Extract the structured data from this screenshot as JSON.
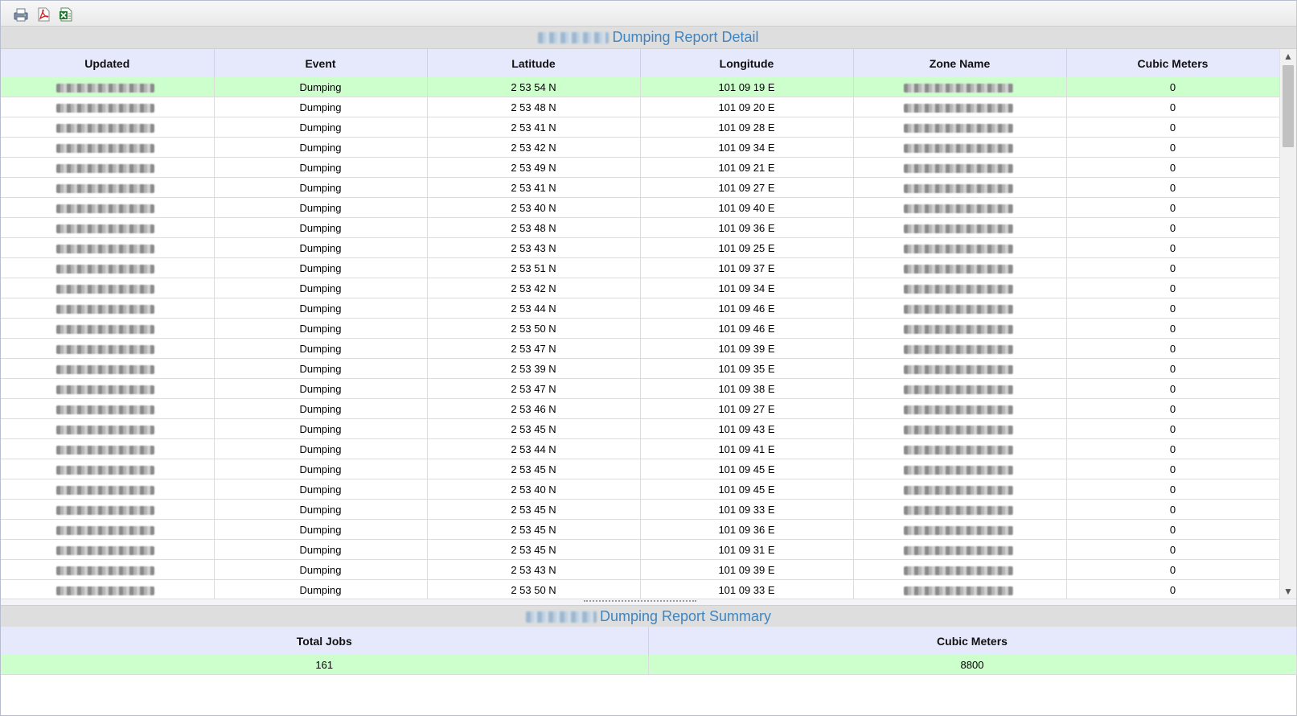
{
  "toolbar": {
    "icons": [
      "print-icon",
      "pdf-icon",
      "excel-icon"
    ]
  },
  "detail": {
    "title": "Dumping Report Detail",
    "columns": [
      "Updated",
      "Event",
      "Latitude",
      "Longitude",
      "Zone Name",
      "Cubic Meters"
    ],
    "rows": [
      {
        "event": "Dumping",
        "latitude": "2 53 54 N",
        "longitude": "101 09 19 E",
        "cubic": "0"
      },
      {
        "event": "Dumping",
        "latitude": "2 53 48 N",
        "longitude": "101 09 20 E",
        "cubic": "0"
      },
      {
        "event": "Dumping",
        "latitude": "2 53 41 N",
        "longitude": "101 09 28 E",
        "cubic": "0"
      },
      {
        "event": "Dumping",
        "latitude": "2 53 42 N",
        "longitude": "101 09 34 E",
        "cubic": "0"
      },
      {
        "event": "Dumping",
        "latitude": "2 53 49 N",
        "longitude": "101 09 21 E",
        "cubic": "0"
      },
      {
        "event": "Dumping",
        "latitude": "2 53 41 N",
        "longitude": "101 09 27 E",
        "cubic": "0"
      },
      {
        "event": "Dumping",
        "latitude": "2 53 40 N",
        "longitude": "101 09 40 E",
        "cubic": "0"
      },
      {
        "event": "Dumping",
        "latitude": "2 53 48 N",
        "longitude": "101 09 36 E",
        "cubic": "0"
      },
      {
        "event": "Dumping",
        "latitude": "2 53 43 N",
        "longitude": "101 09 25 E",
        "cubic": "0"
      },
      {
        "event": "Dumping",
        "latitude": "2 53 51 N",
        "longitude": "101 09 37 E",
        "cubic": "0"
      },
      {
        "event": "Dumping",
        "latitude": "2 53 42 N",
        "longitude": "101 09 34 E",
        "cubic": "0"
      },
      {
        "event": "Dumping",
        "latitude": "2 53 44 N",
        "longitude": "101 09 46 E",
        "cubic": "0"
      },
      {
        "event": "Dumping",
        "latitude": "2 53 50 N",
        "longitude": "101 09 46 E",
        "cubic": "0"
      },
      {
        "event": "Dumping",
        "latitude": "2 53 47 N",
        "longitude": "101 09 39 E",
        "cubic": "0"
      },
      {
        "event": "Dumping",
        "latitude": "2 53 39 N",
        "longitude": "101 09 35 E",
        "cubic": "0"
      },
      {
        "event": "Dumping",
        "latitude": "2 53 47 N",
        "longitude": "101 09 38 E",
        "cubic": "0"
      },
      {
        "event": "Dumping",
        "latitude": "2 53 46 N",
        "longitude": "101 09 27 E",
        "cubic": "0"
      },
      {
        "event": "Dumping",
        "latitude": "2 53 45 N",
        "longitude": "101 09 43 E",
        "cubic": "0"
      },
      {
        "event": "Dumping",
        "latitude": "2 53 44 N",
        "longitude": "101 09 41 E",
        "cubic": "0"
      },
      {
        "event": "Dumping",
        "latitude": "2 53 45 N",
        "longitude": "101 09 45 E",
        "cubic": "0"
      },
      {
        "event": "Dumping",
        "latitude": "2 53 40 N",
        "longitude": "101 09 45 E",
        "cubic": "0"
      },
      {
        "event": "Dumping",
        "latitude": "2 53 45 N",
        "longitude": "101 09 33 E",
        "cubic": "0"
      },
      {
        "event": "Dumping",
        "latitude": "2 53 45 N",
        "longitude": "101 09 36 E",
        "cubic": "0"
      },
      {
        "event": "Dumping",
        "latitude": "2 53 45 N",
        "longitude": "101 09 31 E",
        "cubic": "0"
      },
      {
        "event": "Dumping",
        "latitude": "2 53 43 N",
        "longitude": "101 09 39 E",
        "cubic": "0"
      },
      {
        "event": "Dumping",
        "latitude": "2 53 50 N",
        "longitude": "101 09 33 E",
        "cubic": "0"
      }
    ]
  },
  "summary": {
    "title": "Dumping Report Summary",
    "columns": [
      "Total Jobs",
      "Cubic Meters"
    ],
    "values": [
      "161",
      "8800"
    ]
  },
  "colors": {
    "title_text": "#3e85c2",
    "header_bg": "#e6e8fb",
    "highlight_row": "#ccffcc"
  }
}
